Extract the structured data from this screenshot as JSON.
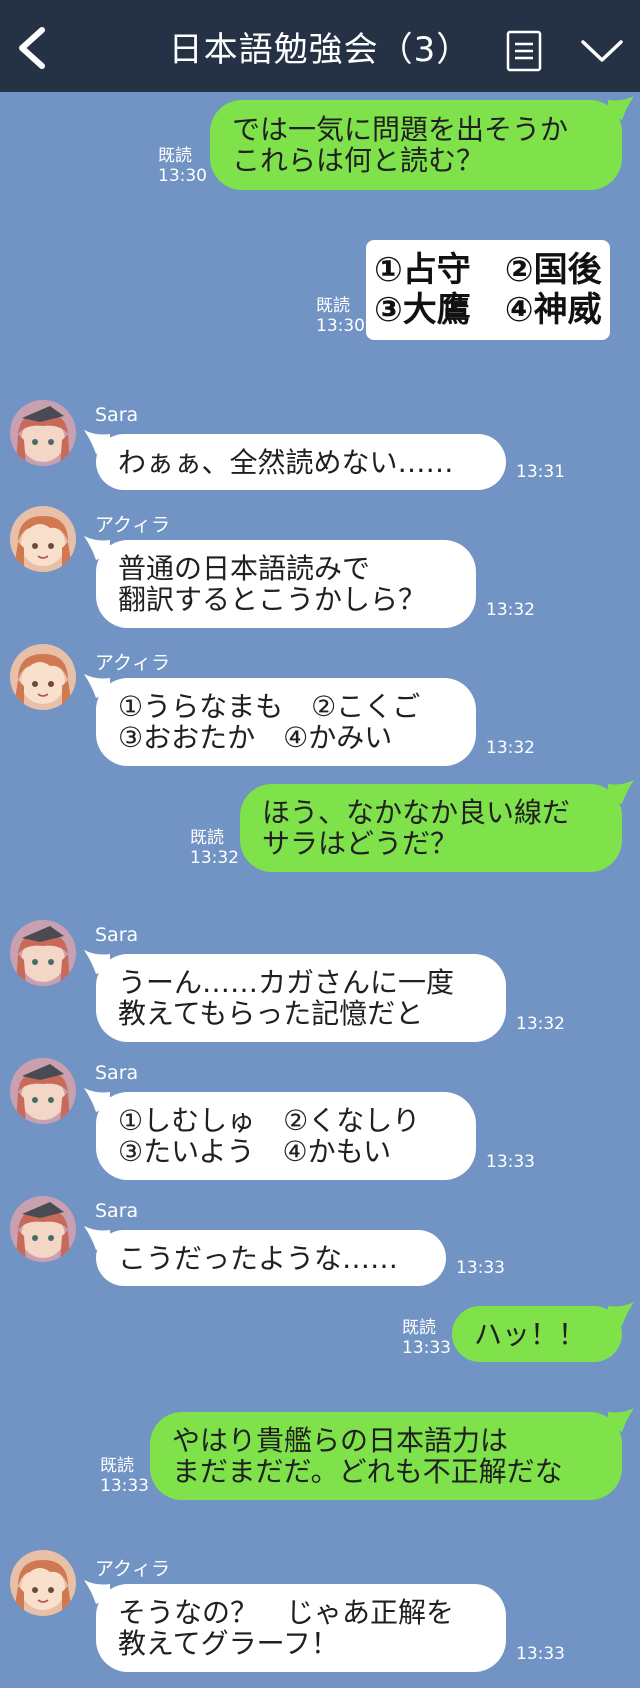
{
  "header": {
    "title": "日本語勉強会（3）",
    "back_icon": "chevron-left-icon",
    "menu_icon": "menu-list-icon",
    "collapse_icon": "chevron-down-icon"
  },
  "colors": {
    "background": "#7294c4",
    "header": "#253246",
    "outgoing": "#7fe24a",
    "incoming": "#ffffff"
  },
  "messages": [
    {
      "id": "m1",
      "dir": "out",
      "text": "では一気に問題を出そうか\nこれらは何と読む？",
      "read": "既読",
      "time": "13:30"
    },
    {
      "id": "m2",
      "dir": "out",
      "card": true,
      "lines": [
        "①占守　②国後",
        "③大鷹　④神威"
      ],
      "read": "既読",
      "time": "13:30"
    },
    {
      "id": "m3",
      "dir": "in",
      "sender": "Sara",
      "text": "わぁぁ、全然読めない……",
      "time": "13:31"
    },
    {
      "id": "m4",
      "dir": "in",
      "sender": "アクィラ",
      "text": "普通の日本語読みで\n翻訳するとこうかしら？",
      "time": "13:32"
    },
    {
      "id": "m5",
      "dir": "in",
      "sender": "アクィラ",
      "text": "①うらなまも　②こくご\n③おおたか　④かみい",
      "time": "13:32"
    },
    {
      "id": "m6",
      "dir": "out",
      "text": "ほう、なかなか良い線だ\nサラはどうだ？",
      "read": "既読",
      "time": "13:32"
    },
    {
      "id": "m7",
      "dir": "in",
      "sender": "Sara",
      "text": "うーん……カガさんに一度\n教えてもらった記憶だと",
      "time": "13:32"
    },
    {
      "id": "m8",
      "dir": "in",
      "sender": "Sara",
      "text": "①しむしゅ　②くなしり\n③たいよう　④かもい",
      "time": "13:33"
    },
    {
      "id": "m9",
      "dir": "in",
      "sender": "Sara",
      "text": "こうだったような……",
      "time": "13:33"
    },
    {
      "id": "m10",
      "dir": "out",
      "text": "ハッ！！",
      "read": "既読",
      "time": "13:33"
    },
    {
      "id": "m11",
      "dir": "out",
      "text": "やはり貴艦らの日本語力は\nまだまだだ。どれも不正解だな",
      "read": "既読",
      "time": "13:33"
    },
    {
      "id": "m12",
      "dir": "in",
      "sender": "アクィラ",
      "text": "そうなの？　じゃあ正解を\n教えてグラーフ！",
      "time": "13:33"
    }
  ]
}
